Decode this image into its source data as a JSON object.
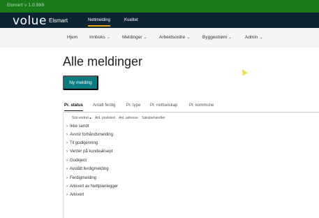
{
  "env": {
    "label": "Elsmart v 1.0.999"
  },
  "brand": {
    "logo": "volue",
    "app_name": "Elsmart",
    "tabs": [
      {
        "label": "Nettmelding",
        "active": true
      },
      {
        "label": "Kvalitet",
        "active": false
      }
    ],
    "accent": "#e8a317",
    "background": "#0f2433"
  },
  "nav": {
    "items": [
      {
        "label": "Hjem",
        "dropdown": false
      },
      {
        "label": "Innboks",
        "dropdown": true
      },
      {
        "label": "Meldinger",
        "dropdown": true
      },
      {
        "label": "Arbeidsordre",
        "dropdown": true
      },
      {
        "label": "Byggestrøm",
        "dropdown": true
      },
      {
        "label": "Admin",
        "dropdown": true
      }
    ]
  },
  "page": {
    "title": "Alle meldinger",
    "new_button": "Ny melding",
    "button_color": "#0c7a82"
  },
  "tabs": [
    {
      "label": "Pr. status",
      "active": true
    },
    {
      "label": "Antatt ferdig",
      "active": false
    },
    {
      "label": "Pr. type",
      "active": false
    },
    {
      "label": "Pr. nettselskap",
      "active": false
    },
    {
      "label": "Pr. kommune",
      "active": false
    }
  ],
  "columns": [
    "Sist endret ▴",
    "Anl. poststed",
    "Anl. adresse",
    "Saksbehandler"
  ],
  "groups": [
    "Ikke sendt",
    "Avvist forhåndsmelding",
    "Til godkjenning",
    "Venter på kundeaksept",
    "Godkjent",
    "Avslått ferdigmelding",
    "Ferdigmelding",
    "Arkivert av Nettplanlegger",
    "Arkivert"
  ]
}
